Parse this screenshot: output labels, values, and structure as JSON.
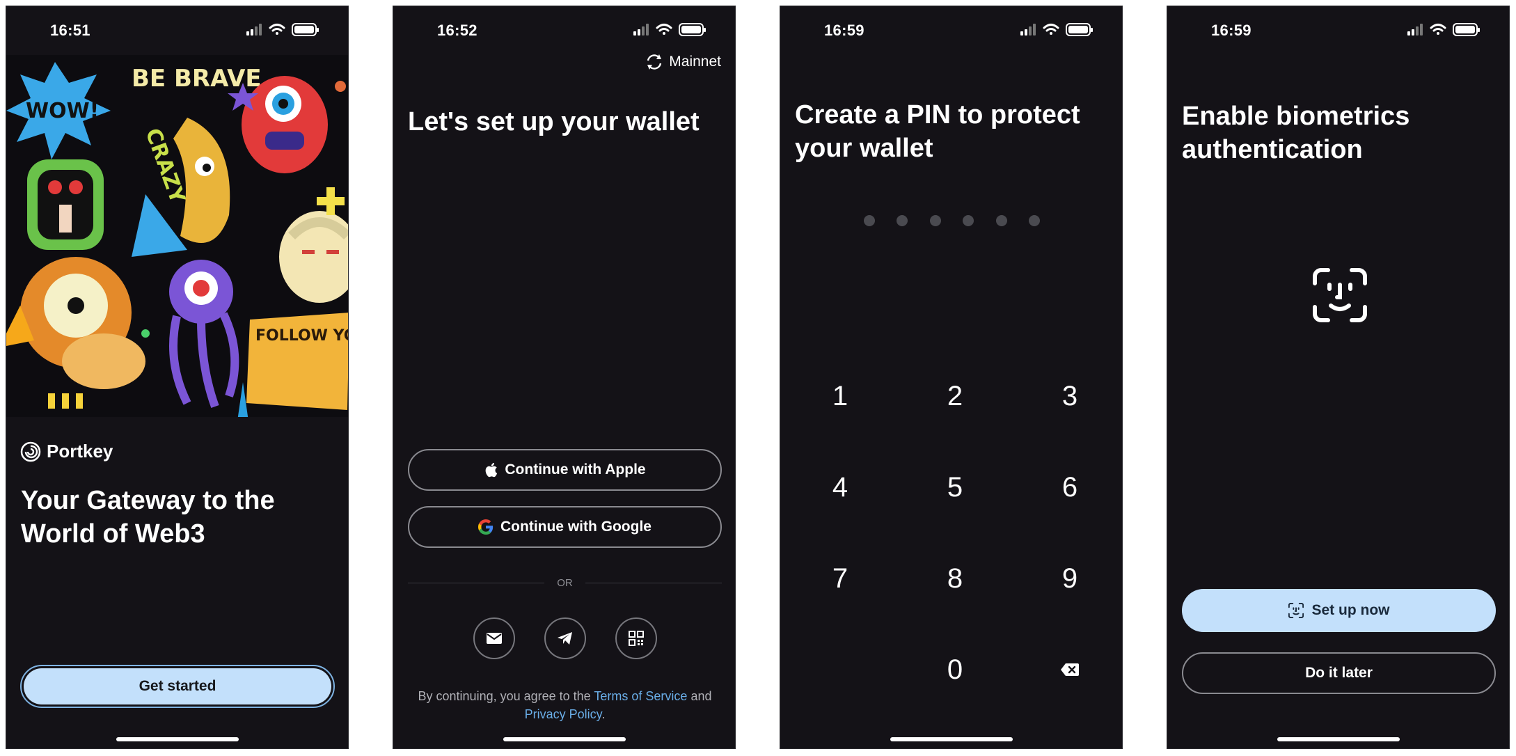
{
  "screens": [
    {
      "status": {
        "time": "16:51"
      },
      "brand": "Portkey",
      "headline": "Your Gateway to the World of Web3",
      "primary_button": "Get started",
      "art_text": {
        "wow": "WOW!",
        "be_brave": "BE BRAVE",
        "crazy": "CRAZY",
        "follow_your_dream": "FOLLOW YOUR DREAM"
      }
    },
    {
      "status": {
        "time": "16:52"
      },
      "network": "Mainnet",
      "title": "Let's set up your wallet",
      "apple_button": "Continue with Apple",
      "google_button": "Continue with Google",
      "divider": "OR",
      "alt_login_icons": [
        "email-icon",
        "telegram-icon",
        "qr-code-icon"
      ],
      "legal": {
        "prefix": "By continuing, you agree to the",
        "terms": "Terms of Service",
        "and": "and",
        "privacy": "Privacy Policy",
        "suffix": "."
      }
    },
    {
      "status": {
        "time": "16:59"
      },
      "title": "Create a PIN to protect your wallet",
      "pin_length": 6,
      "keys": [
        "1",
        "2",
        "3",
        "4",
        "5",
        "6",
        "7",
        "8",
        "9",
        "0"
      ]
    },
    {
      "status": {
        "time": "16:59"
      },
      "title": "Enable biometrics authentication",
      "setup_button": "Set up now",
      "later_button": "Do it later"
    }
  ],
  "colors": {
    "background": "#141217",
    "accent_light": "#c3e0fb",
    "link": "#6aaee8",
    "outline": "#8a8a90"
  }
}
